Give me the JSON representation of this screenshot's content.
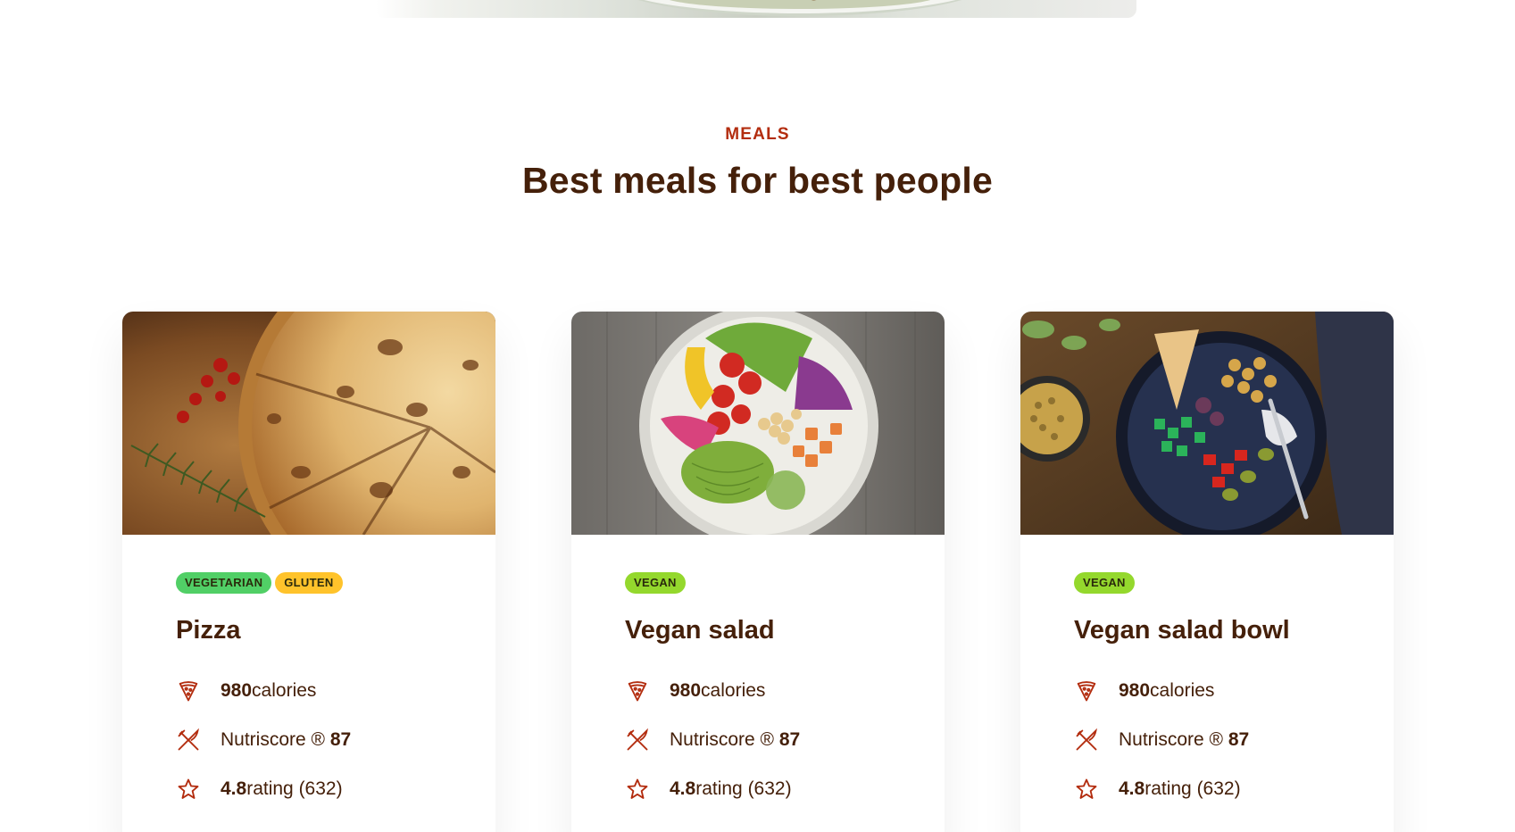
{
  "section": {
    "eyebrow": "MEALS",
    "title": "Best meals for best people"
  },
  "colors": {
    "accent": "#b32d0f",
    "heading": "#45200a",
    "tag_vegetarian": "#51cf66",
    "tag_vegan": "#94d82d",
    "tag_gluten": "#ffc32b"
  },
  "meals": [
    {
      "name": "Pizza",
      "tags": [
        "VEGETARIAN",
        "GLUTEN"
      ],
      "calories_value": "980",
      "calories_unit": "calories",
      "nutri_label": "Nutriscore ®",
      "nutri_value": "87",
      "rating_value": "4.8",
      "rating_text": "rating (632)",
      "image_icon": "pizza-photo"
    },
    {
      "name": "Vegan salad",
      "tags": [
        "VEGAN"
      ],
      "calories_value": "980",
      "calories_unit": "calories",
      "nutri_label": "Nutriscore ®",
      "nutri_value": "87",
      "rating_value": "4.8",
      "rating_text": "rating (632)",
      "image_icon": "salad-photo"
    },
    {
      "name": "Vegan salad bowl",
      "tags": [
        "VEGAN"
      ],
      "calories_value": "980",
      "calories_unit": "calories",
      "nutri_label": "Nutriscore ®",
      "nutri_value": "87",
      "rating_value": "4.8",
      "rating_text": "rating (632)",
      "image_icon": "salad-bowl-photo"
    }
  ],
  "icons": {
    "calories": "pizza-slice-icon",
    "nutriscore": "utensils-icon",
    "rating": "star-icon"
  }
}
